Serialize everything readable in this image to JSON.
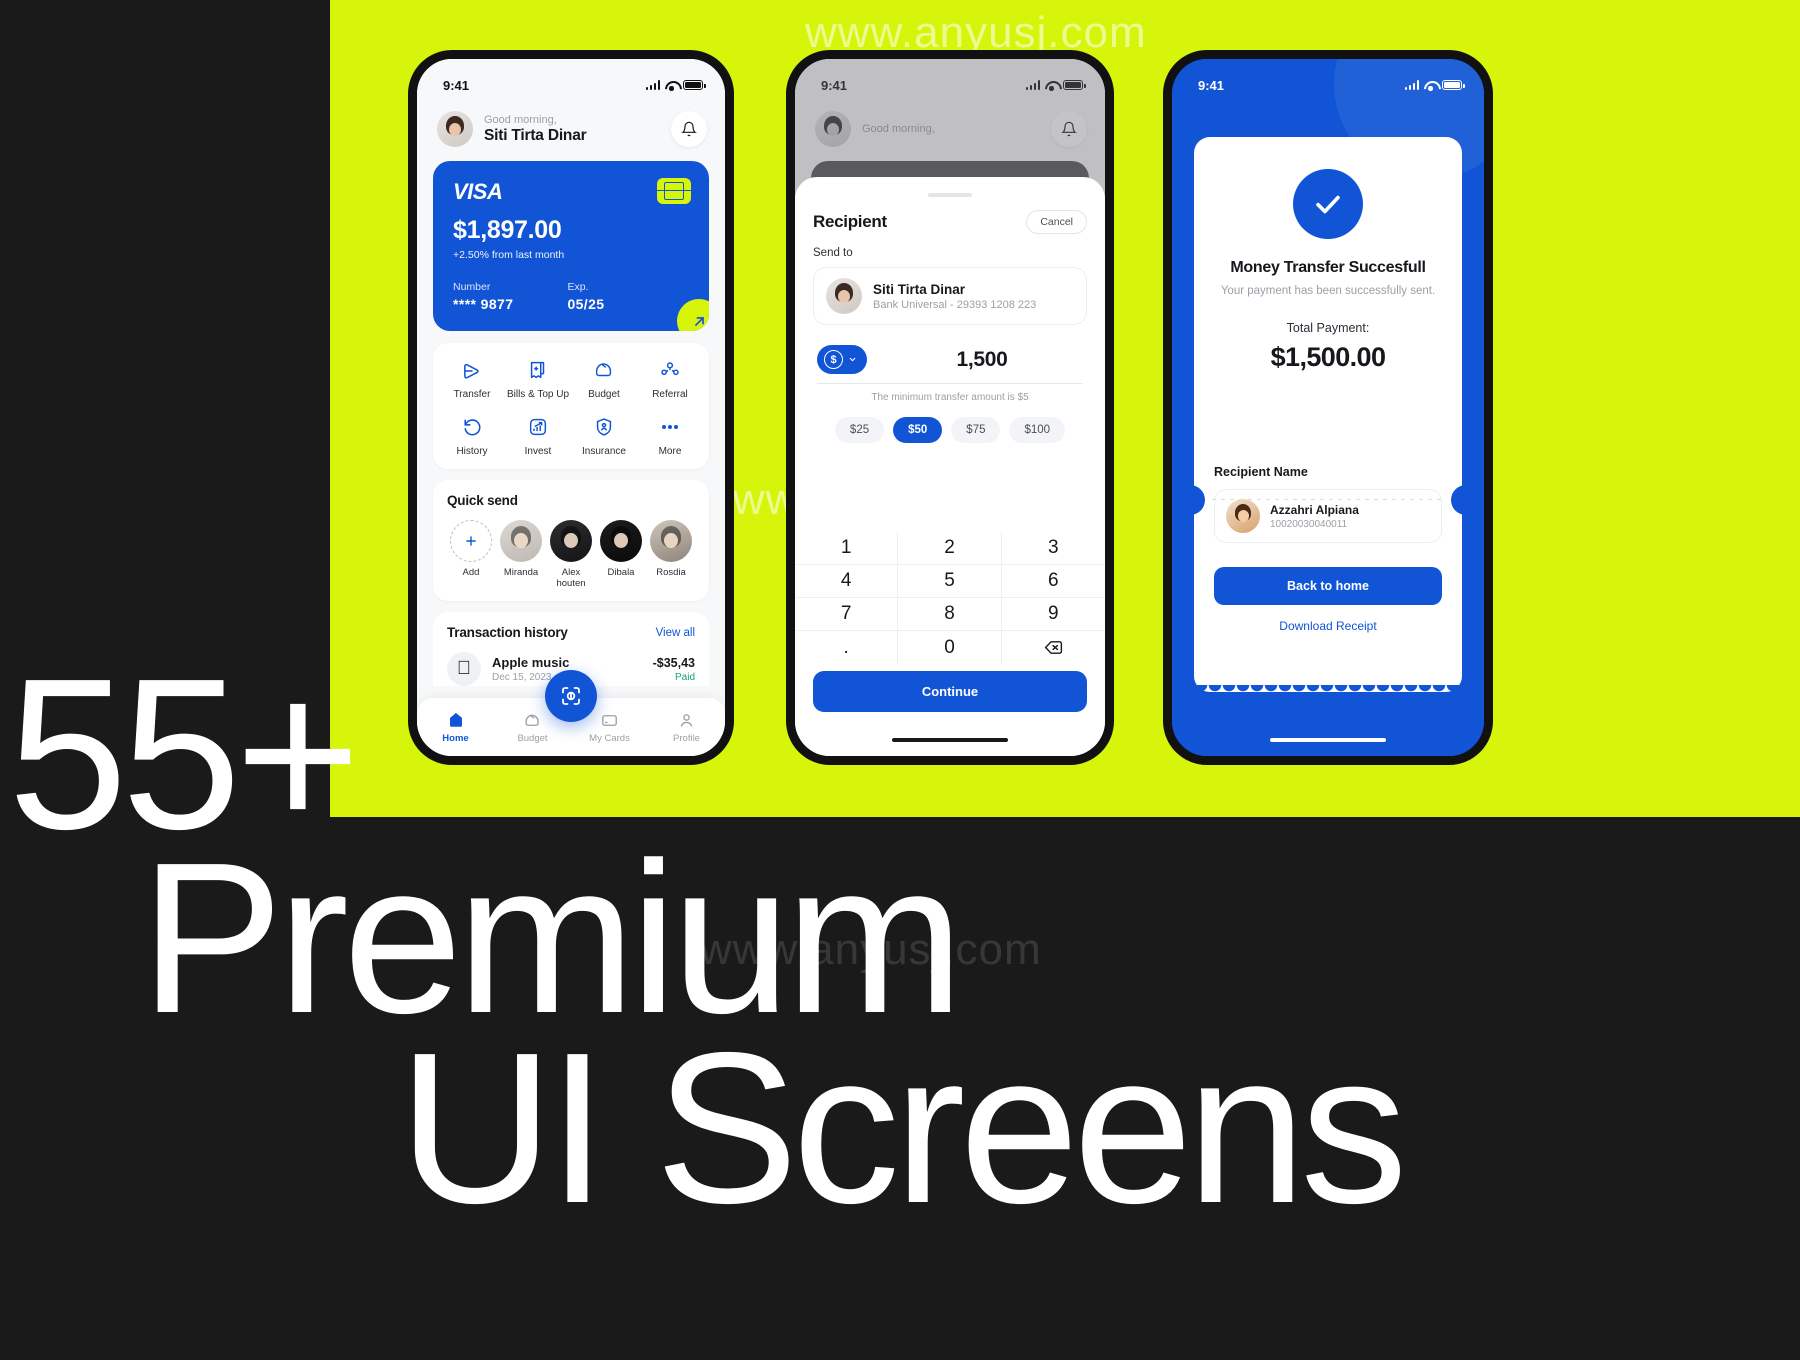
{
  "promo": {
    "line1": "55+",
    "line2": "Premium",
    "line3": "UI Screens"
  },
  "watermark": {
    "text": "www.anyusj.com"
  },
  "colors": {
    "lime": "#d6f50a",
    "brand_blue": "#1155d6",
    "dark_bg": "#1a1a1a",
    "success_green": "#17a673"
  },
  "screen_home": {
    "status": {
      "time": "9:41"
    },
    "header": {
      "greeting": "Good morning,",
      "name": "Siti Tirta Dinar",
      "bell_icon": "bell-icon"
    },
    "card": {
      "brand": "VISA",
      "balance": "$1,897.00",
      "change": "+2.50% from last month",
      "number_label": "Number",
      "number_value": "**** 9877",
      "exp_label": "Exp.",
      "exp_value": "05/25",
      "chip_icon": "card-chip-icon",
      "action_icon": "arrow-up-right-icon"
    },
    "menu": [
      {
        "label": "Transfer",
        "icon": "send-plane-icon"
      },
      {
        "label": "Bills & Top Up",
        "icon": "receipt-plus-icon"
      },
      {
        "label": "Budget",
        "icon": "wallet-icon"
      },
      {
        "label": "Referral",
        "icon": "users-group-icon"
      },
      {
        "label": "History",
        "icon": "history-rotate-icon"
      },
      {
        "label": "Invest",
        "icon": "chart-growth-icon"
      },
      {
        "label": "Insurance",
        "icon": "shield-person-icon"
      },
      {
        "label": "More",
        "icon": "dots-horizontal-icon"
      }
    ],
    "quick_send": {
      "title": "Quick send",
      "items": [
        {
          "label": "Add",
          "icon": "plus-icon"
        },
        {
          "label": "Miranda",
          "icon": "avatar"
        },
        {
          "label": "Alex houten",
          "icon": "avatar"
        },
        {
          "label": "Dibala",
          "icon": "avatar"
        },
        {
          "label": "Rosdia",
          "icon": "avatar"
        }
      ]
    },
    "transactions": {
      "title": "Transaction history",
      "view_all": "View all",
      "rows": [
        {
          "icon": "apple-icon",
          "name": "Apple music",
          "date": "Dec 15, 2023",
          "amount": "-$35,43",
          "status": "Paid"
        }
      ]
    },
    "scan_fab_icon": "scan-qr-icon",
    "nav": [
      {
        "label": "Home",
        "icon": "home-icon",
        "active": true
      },
      {
        "label": "Budget",
        "icon": "wallet-icon",
        "active": false
      },
      {
        "label": "My Cards",
        "icon": "credit-card-icon",
        "active": false
      },
      {
        "label": "Profile",
        "icon": "person-icon",
        "active": false
      }
    ]
  },
  "screen_recipient": {
    "status": {
      "time": "9:41"
    },
    "bg_header": {
      "greeting": "Good morning,"
    },
    "sheet": {
      "title": "Recipient",
      "cancel_label": "Cancel",
      "send_to_label": "Send to",
      "recipient_name": "Siti Tirta Dinar",
      "recipient_bank": "Bank Universal - 29393 1208 223",
      "currency_symbol": "$",
      "currency_caret_icon": "chevron-down-icon",
      "amount_value": "1,500",
      "min_hint": "The minimum transfer amount is $5",
      "chips": [
        {
          "label": "$25",
          "active": false
        },
        {
          "label": "$50",
          "active": true
        },
        {
          "label": "$75",
          "active": false
        },
        {
          "label": "$100",
          "active": false
        }
      ],
      "keypad": [
        "1",
        "2",
        "3",
        "4",
        "5",
        "6",
        "7",
        "8",
        "9",
        ".",
        "0",
        "backspace-icon"
      ],
      "continue_label": "Continue"
    }
  },
  "screen_success": {
    "status": {
      "time": "9:41"
    },
    "check_icon": "check-circle-icon",
    "title": "Money Transfer Succesfull",
    "subtitle": "Your payment has been successfully sent.",
    "total_label": "Total Payment:",
    "total_value": "$1,500.00",
    "recipient_label": "Recipient Name",
    "recipient_name": "Azzahri Alpiana",
    "recipient_account": "10020030040011",
    "primary_button": "Back to home",
    "secondary_link": "Download Receipt"
  }
}
